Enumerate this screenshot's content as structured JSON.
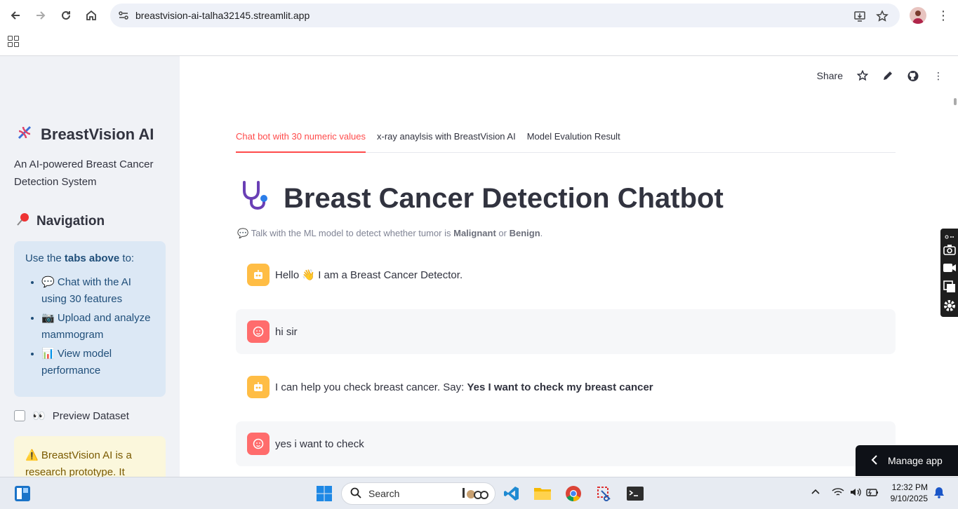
{
  "browser": {
    "url": "breastvision-ai-talha32145.streamlit.app"
  },
  "sidebar": {
    "app_title": "BreastVision AI",
    "app_subtitle": "An AI-powered Breast Cancer Detection System",
    "nav_heading": "Navigation",
    "info_intro_prefix": "Use the ",
    "info_intro_bold": "tabs above",
    "info_intro_suffix": " to:",
    "info_items": [
      {
        "icon": "💬",
        "label": "Chat with the AI using 30 features"
      },
      {
        "icon": "📷",
        "label": "Upload and analyze mammogram"
      },
      {
        "icon": "📊",
        "label": "View model performance"
      }
    ],
    "checkbox_label": "Preview Dataset",
    "checkbox_checked": false,
    "warning_text": "BreastVision AI is a research prototype. It"
  },
  "toolbar": {
    "share_label": "Share"
  },
  "tabs": [
    {
      "label": "Chat bot with 30 numeric values",
      "active": true
    },
    {
      "label": "x-ray anaylsis with BreastVision AI",
      "active": false
    },
    {
      "label": "Model Evalution Result",
      "active": false
    }
  ],
  "main": {
    "title": "Breast Cancer Detection Chatbot",
    "caption_prefix": "Talk with the ML model to detect whether tumor is ",
    "caption_malignant": "Malignant",
    "caption_or": " or ",
    "caption_benign": "Benign",
    "caption_suffix": "."
  },
  "messages": [
    {
      "role": "bot",
      "text": "Hello 👋 I am a Breast Cancer Detector.",
      "bold": ""
    },
    {
      "role": "user",
      "text": "hi sir",
      "bold": ""
    },
    {
      "role": "bot",
      "text": "I can help you check breast cancer. Say: ",
      "bold": "Yes I want to check my breast cancer"
    },
    {
      "role": "user",
      "text": "yes i want to check",
      "bold": ""
    }
  ],
  "manage_app": {
    "label": "Manage app"
  },
  "taskbar": {
    "search_placeholder": "Search",
    "time": "12:32 PM",
    "date": "9/10/2025"
  },
  "colors": {
    "accent": "#ff4b4b",
    "sidebar_bg": "#f0f2f6",
    "info_bg": "#dce8f5",
    "warning_bg": "#fbf7dc",
    "bot_avatar": "#ffbd45",
    "user_avatar": "#ff6c6c"
  }
}
